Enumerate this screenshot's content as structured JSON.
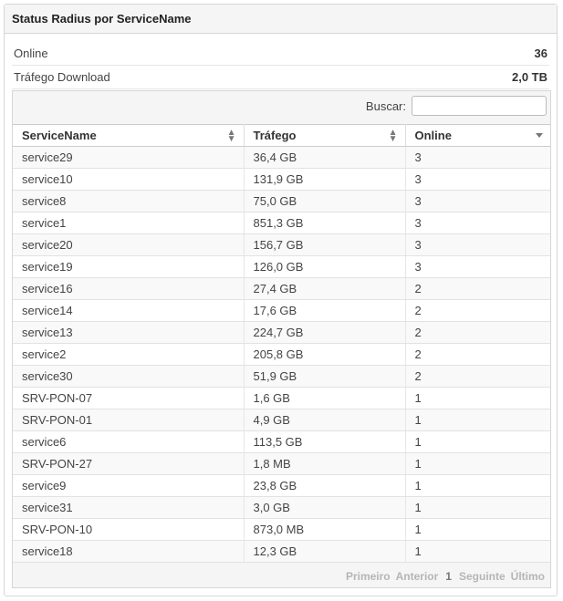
{
  "panel": {
    "title": "Status Radius por ServiceName"
  },
  "stats": [
    {
      "label": "Online",
      "value": "36"
    },
    {
      "label": "Tráfego Download",
      "value": "2,0 TB"
    }
  ],
  "search": {
    "label": "Buscar:",
    "value": "",
    "placeholder": ""
  },
  "table": {
    "columns": [
      "ServiceName",
      "Tráfego",
      "Online"
    ],
    "rows": [
      [
        "service29",
        "36,4 GB",
        "3"
      ],
      [
        "service10",
        "131,9 GB",
        "3"
      ],
      [
        "service8",
        "75,0 GB",
        "3"
      ],
      [
        "service1",
        "851,3 GB",
        "3"
      ],
      [
        "service20",
        "156,7 GB",
        "3"
      ],
      [
        "service19",
        "126,0 GB",
        "3"
      ],
      [
        "service16",
        "27,4 GB",
        "2"
      ],
      [
        "service14",
        "17,6 GB",
        "2"
      ],
      [
        "service13",
        "224,7 GB",
        "2"
      ],
      [
        "service2",
        "205,8 GB",
        "2"
      ],
      [
        "service30",
        "51,9 GB",
        "2"
      ],
      [
        "SRV-PON-07",
        "1,6 GB",
        "1"
      ],
      [
        "SRV-PON-01",
        "4,9 GB",
        "1"
      ],
      [
        "service6",
        "113,5 GB",
        "1"
      ],
      [
        "SRV-PON-27",
        "1,8 MB",
        "1"
      ],
      [
        "service9",
        "23,8 GB",
        "1"
      ],
      [
        "service31",
        "3,0 GB",
        "1"
      ],
      [
        "SRV-PON-10",
        "873,0 MB",
        "1"
      ],
      [
        "service18",
        "12,3 GB",
        "1"
      ]
    ]
  },
  "pager": {
    "first": "Primeiro",
    "prev": "Anterior",
    "page": "1",
    "next": "Seguinte",
    "last": "Último"
  }
}
